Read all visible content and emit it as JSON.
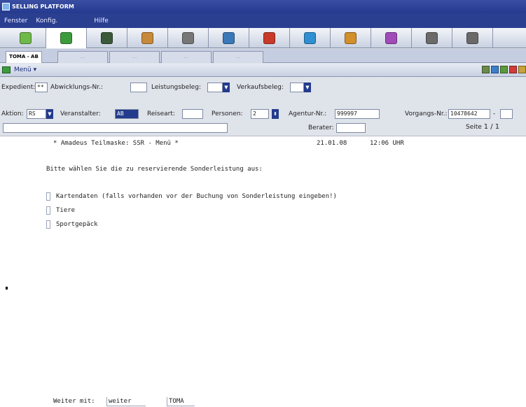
{
  "window": {
    "title": "SELLING PLATFORM"
  },
  "menubar": {
    "items": [
      "Fenster",
      "Konfig.",
      "Hilfe"
    ]
  },
  "toolbar": {
    "buttons": [
      {
        "icon": "book-icon",
        "color": "#6fb84a"
      },
      {
        "icon": "folder-green-icon",
        "color": "#3c9c3c"
      },
      {
        "icon": "monitor-icon",
        "color": "#3a5a3a"
      },
      {
        "icon": "globe-person-icon",
        "color": "#c78a3a"
      },
      {
        "icon": "airplane-icon",
        "color": "#777777"
      },
      {
        "icon": "car-icon",
        "color": "#3a78b8"
      },
      {
        "icon": "person-red-icon",
        "color": "#c83a2a"
      },
      {
        "icon": "umbrella-icon",
        "color": "#2f8fd2"
      },
      {
        "icon": "flower-icon",
        "color": "#d28f2a"
      },
      {
        "icon": "tag-icon",
        "color": "#a04bb8"
      },
      {
        "icon": "printer-icon",
        "color": "#6a6a6a"
      },
      {
        "icon": "more-icon",
        "color": "#6a6a6a"
      }
    ]
  },
  "tabs": [
    {
      "label": "TOMA - AB",
      "active": true
    },
    {
      "label": "...",
      "active": false
    },
    {
      "label": "...",
      "active": false
    },
    {
      "label": "...",
      "active": false
    },
    {
      "label": "...",
      "active": false
    }
  ],
  "submenu": {
    "label": "Menü ▾"
  },
  "form": {
    "expedient_label": "Expedient:",
    "expedient_value": "**",
    "abwicklungs_label": "Abwicklungs-Nr.:",
    "abwicklungs_value": "",
    "leistungsbeleg_label": "Leistungsbeleg:",
    "leistungsbeleg_value": "",
    "verkaufsbeleg_label": "Verkaufsbeleg:",
    "verkaufsbeleg_value": "",
    "aktion_label": "Aktion:",
    "aktion_value": "RS",
    "veranstalter_label": "Veranstalter:",
    "veranstalter_value": "AB",
    "reiseart_label": "Reiseart:",
    "reiseart_value": "",
    "personen_label": "Personen:",
    "personen_value": "2",
    "agentur_label": "Agentur-Nr.:",
    "agentur_value": "999997",
    "vorgangs_label": "Vorgangs-Nr.:",
    "vorgangs_value": "10478642",
    "vorgangs_dash": "-",
    "vorgangs_suffix": "",
    "command_value": "",
    "berater_label": "Berater:",
    "berater_value": "",
    "seite_label": "Seite",
    "seite_value": "1 / 1"
  },
  "terminal": {
    "header": "* Amadeus Teilmaske: SSR - Menü *",
    "date": "21.01.08",
    "time": "12:06 UHR",
    "prompt": "Bitte wählen Sie die zu reservierende Sonderleistung aus:",
    "options": [
      "Kartendaten (falls vorhanden vor der Buchung von Sonderleistung eingeben!)",
      "Tiere",
      "Sportgepäck"
    ],
    "weiter_label": "Weiter mit:",
    "weiter_value": "weiter",
    "toma_value": "TOMA"
  }
}
